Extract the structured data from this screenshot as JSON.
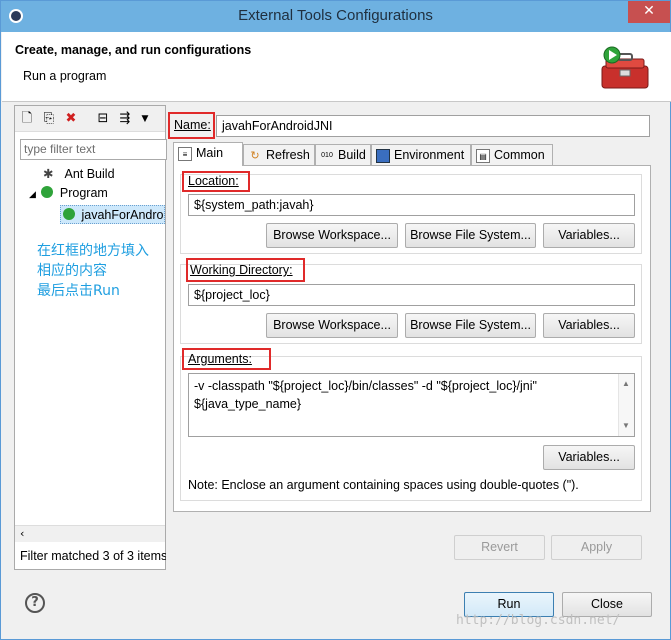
{
  "window": {
    "title": "External Tools Configurations",
    "close_glyph": "✕"
  },
  "header": {
    "title": "Create, manage, and run configurations",
    "subtitle": "Run a program"
  },
  "left": {
    "filter_placeholder": "type filter text",
    "tree": [
      {
        "label": "Ant Build",
        "icon": "ant-icon"
      },
      {
        "label": "Program",
        "icon": "program-icon",
        "expanded": true
      },
      {
        "label": "javahForAndroidJNI",
        "icon": "run-config-icon",
        "selected": true
      }
    ],
    "annotation": [
      "在红框的地方填入",
      "相应的内容",
      "最后点击Run"
    ],
    "filter_message": "Filter matched 3 of 3 items"
  },
  "name_label": "Name:",
  "name_value": "javahForAndroidJNI",
  "tabs": [
    {
      "label": "Main",
      "icon": "main-icon",
      "active": true
    },
    {
      "label": "Refresh",
      "icon": "refresh-icon"
    },
    {
      "label": "Build",
      "icon": "build-icon"
    },
    {
      "label": "Environment",
      "icon": "environment-icon"
    },
    {
      "label": "Common",
      "icon": "common-icon"
    }
  ],
  "location": {
    "label": "Location:",
    "value": "${system_path:javah}",
    "btn_workspace": "Browse Workspace...",
    "btn_filesystem": "Browse File System...",
    "btn_variables": "Variables..."
  },
  "workdir": {
    "label": "Working Directory:",
    "value": "${project_loc}",
    "btn_workspace": "Browse Workspace...",
    "btn_filesystem": "Browse File System...",
    "btn_variables": "Variables..."
  },
  "arguments": {
    "label": "Arguments:",
    "line1": "-v -classpath \"${project_loc}/bin/classes\" -d \"${project_loc}/jni\"",
    "line2": "${java_type_name}",
    "btn_variables": "Variables...",
    "note": "Note: Enclose an argument containing spaces using double-quotes (\")."
  },
  "actions": {
    "revert": "Revert",
    "apply": "Apply",
    "run": "Run",
    "close": "Close"
  },
  "help_glyph": "?",
  "watermark": "http://blog.csdn.net/"
}
